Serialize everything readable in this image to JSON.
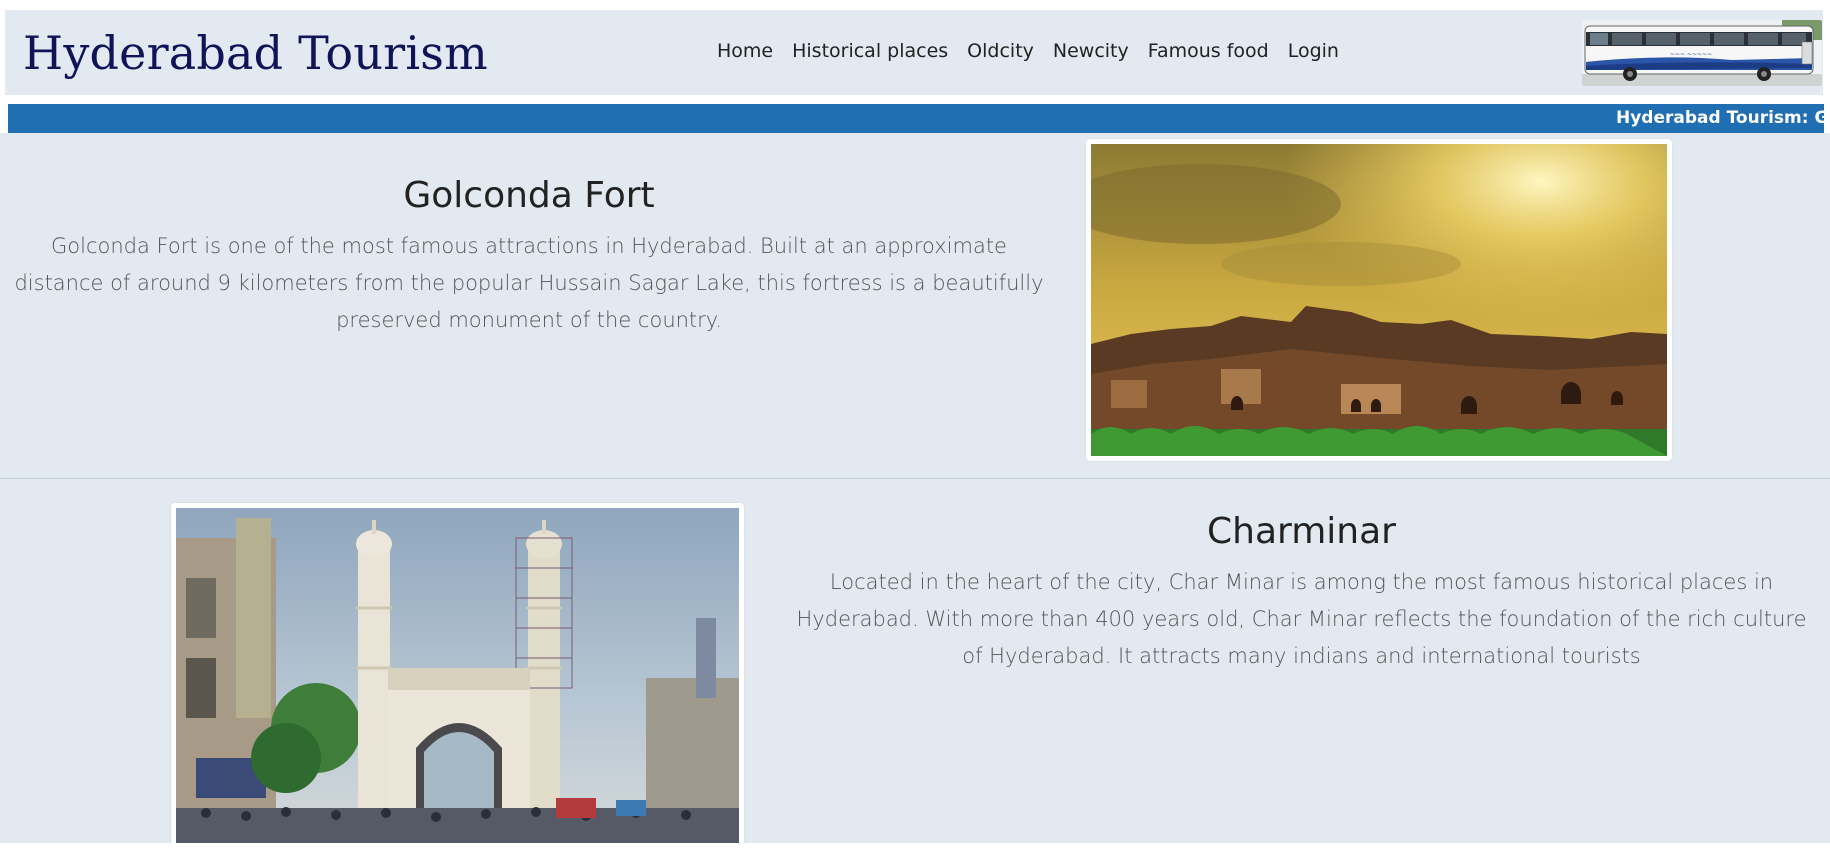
{
  "header": {
    "brand": "Hyderabad Tourism",
    "nav": [
      "Home",
      "Historical places",
      "Oldcity",
      "Newcity",
      "Famous food",
      "Login"
    ],
    "bus_image": "bus-image"
  },
  "ticker": {
    "text": "Hyderabad Tourism: Golc"
  },
  "places": [
    {
      "title": "Golconda Fort",
      "description": "Golconda Fort is one of the most famous attractions in Hyderabad. Built at an approximate distance of around 9 kilometers from the popular Hussain Sagar Lake, this fortress is a beautifully preserved monument of the country.",
      "image": "golconda-fort-photo"
    },
    {
      "title": "Charminar",
      "description": "Located in the heart of the city, Char Minar is among the most famous historical places in Hyderabad. With more than 400 years old, Char Minar reflects the foundation of the rich culture of Hyderabad. It attracts many indians and international tourists",
      "image": "charminar-photo"
    }
  ],
  "colors": {
    "page_bg": "#e2e9f0",
    "brand": "#0f1459",
    "ticker_bg": "#1f6fb2"
  }
}
